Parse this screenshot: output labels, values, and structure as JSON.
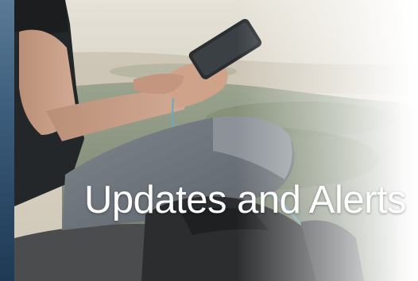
{
  "hero": {
    "title": "Updates and Alerts",
    "image": "person-using-phone-outdoors"
  },
  "colors": {
    "left_panel": "#2c4a67",
    "title_text": "#ffffff",
    "fade": "#ffffff"
  }
}
